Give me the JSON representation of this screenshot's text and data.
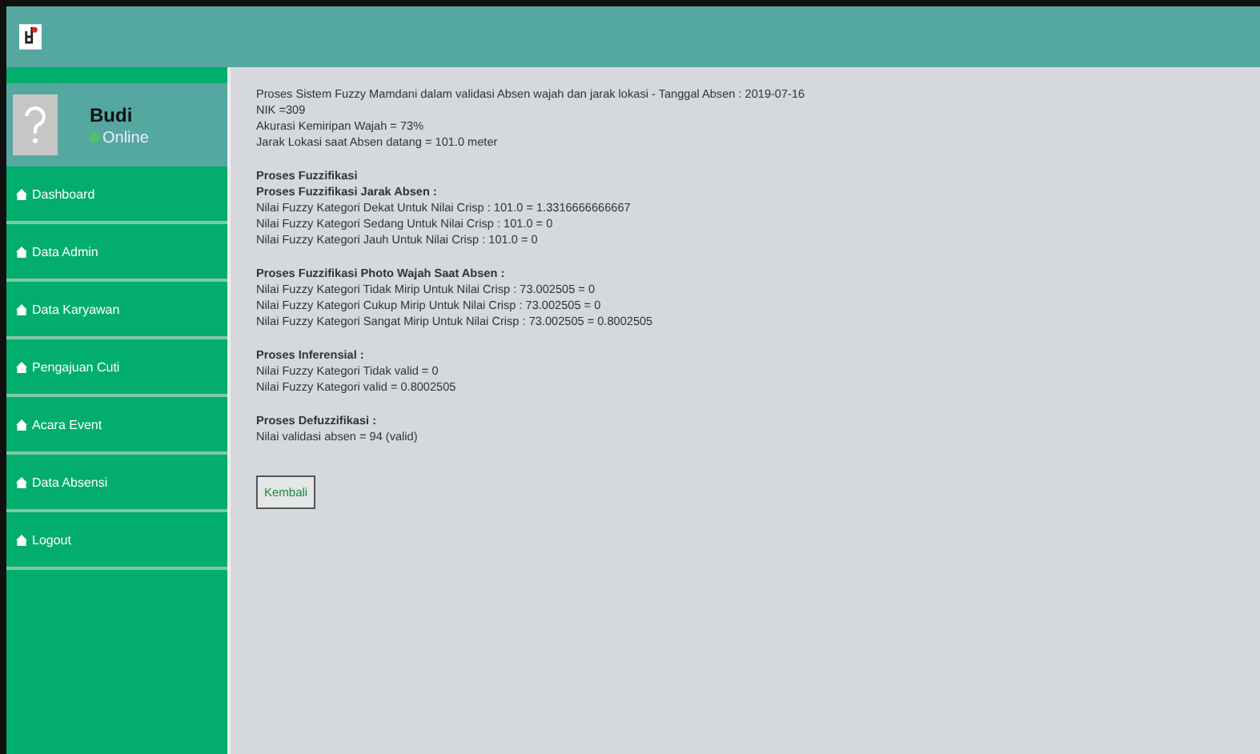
{
  "user": {
    "name": "Budi",
    "status": "Online"
  },
  "menu": [
    {
      "label": "Dashboard"
    },
    {
      "label": "Data Admin"
    },
    {
      "label": "Data Karyawan"
    },
    {
      "label": "Pengajuan Cuti"
    },
    {
      "label": "Acara Event"
    },
    {
      "label": "Data Absensi"
    },
    {
      "label": "Logout"
    }
  ],
  "blocks": [
    {
      "lines": [
        {
          "kind": "text",
          "text": "Proses Sistem Fuzzy Mamdani dalam validasi Absen wajah dan jarak lokasi - Tanggal Absen : 2019-07-16"
        },
        {
          "kind": "text",
          "text": "NIK =309"
        },
        {
          "kind": "text",
          "text": "Akurasi Kemiripan Wajah = 73%"
        },
        {
          "kind": "text",
          "text": "Jarak Lokasi saat Absen datang = 101.0 meter"
        }
      ]
    },
    {
      "lines": [
        {
          "kind": "heading",
          "text": "Proses Fuzzifikasi"
        },
        {
          "kind": "heading",
          "text": "Proses Fuzzifikasi Jarak Absen :"
        },
        {
          "kind": "text",
          "text": "Nilai Fuzzy Kategori Dekat Untuk Nilai Crisp : 101.0 = 1.3316666666667"
        },
        {
          "kind": "text",
          "text": "Nilai Fuzzy Kategori Sedang Untuk Nilai Crisp : 101.0 = 0"
        },
        {
          "kind": "text",
          "text": "Nilai Fuzzy Kategori Jauh Untuk Nilai Crisp : 101.0 = 0"
        }
      ]
    },
    {
      "lines": [
        {
          "kind": "heading",
          "text": "Proses Fuzzifikasi Photo Wajah Saat Absen :"
        },
        {
          "kind": "text",
          "text": "Nilai Fuzzy Kategori Tidak Mirip Untuk Nilai Crisp : 73.002505 = 0"
        },
        {
          "kind": "text",
          "text": "Nilai Fuzzy Kategori Cukup Mirip Untuk Nilai Crisp : 73.002505 = 0"
        },
        {
          "kind": "text",
          "text": "Nilai Fuzzy Kategori Sangat Mirip Untuk Nilai Crisp : 73.002505 = 0.8002505"
        }
      ]
    },
    {
      "lines": [
        {
          "kind": "heading",
          "text": "Proses Inferensial :"
        },
        {
          "kind": "text",
          "text": "Nilai Fuzzy Kategori Tidak valid = 0"
        },
        {
          "kind": "text",
          "text": "Nilai Fuzzy Kategori valid = 0.8002505"
        }
      ]
    },
    {
      "lines": [
        {
          "kind": "heading",
          "text": "Proses Defuzzifikasi :"
        },
        {
          "kind": "text",
          "text": "Nilai validasi absen = 94 (valid)"
        }
      ]
    }
  ],
  "back_button": "Kembali"
}
